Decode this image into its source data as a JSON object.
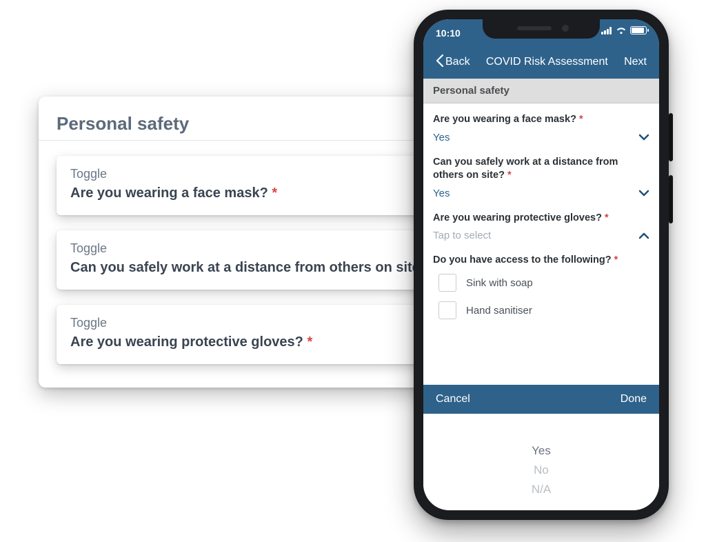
{
  "web_panel": {
    "title": "Personal safety",
    "items": [
      {
        "type": "Toggle",
        "question": "Are you wearing a face mask?",
        "required": true
      },
      {
        "type": "Toggle",
        "question": "Can you safely work at a distance from others on site?",
        "required": true
      },
      {
        "type": "Toggle",
        "question": "Are you wearing protective gloves?",
        "required": true
      }
    ]
  },
  "phone": {
    "status": {
      "time": "10:10"
    },
    "nav": {
      "back": "Back",
      "title": "COVID Risk Assessment",
      "next": "Next"
    },
    "section_title": "Personal safety",
    "fields": [
      {
        "label": "Are you wearing a face mask?",
        "value": "Yes",
        "state": "filled",
        "chevron": "down"
      },
      {
        "label": "Can you safely work at a distance from others on site?",
        "value": "Yes",
        "state": "filled",
        "chevron": "down"
      },
      {
        "label": "Are you wearing protective gloves?",
        "value": "Tap to select",
        "state": "placeholder",
        "chevron": "up"
      }
    ],
    "checklist": {
      "label": "Do you have access to the following?",
      "options": [
        "Sink with soap",
        "Hand sanitiser"
      ]
    },
    "picker": {
      "cancel": "Cancel",
      "done": "Done",
      "options": [
        "Yes",
        "No",
        "N/A"
      ]
    }
  },
  "asterisk": "*"
}
